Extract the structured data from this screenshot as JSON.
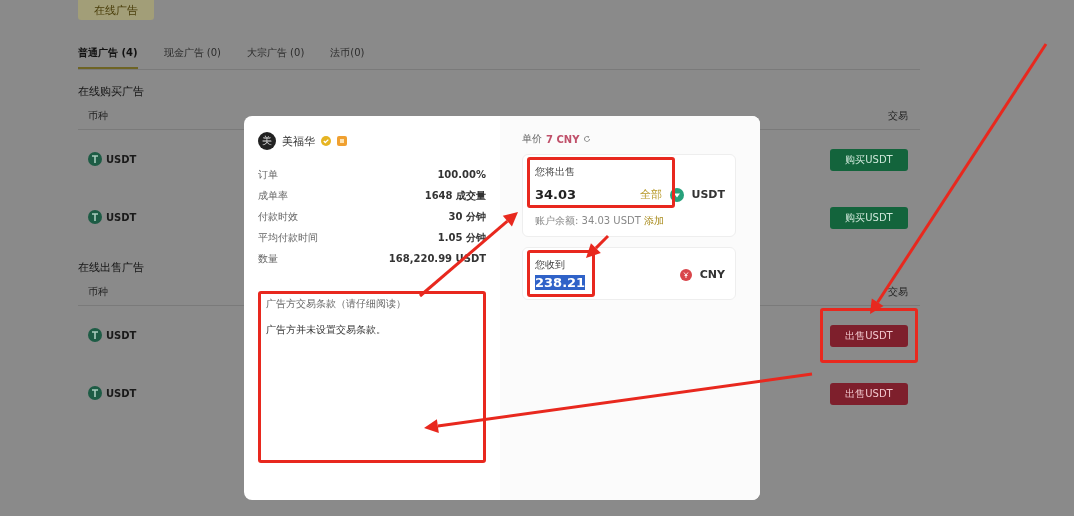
{
  "top_button": "在线广告",
  "tabs": [
    {
      "label": "普通广告 (4)",
      "selected": true
    },
    {
      "label": "现金广告 (0)",
      "selected": false
    },
    {
      "label": "大宗广告 (0)",
      "selected": false
    },
    {
      "label": "法币(0)",
      "selected": false
    }
  ],
  "sections": [
    {
      "title": "在线购买广告",
      "columns": [
        "币种",
        "交易"
      ],
      "rows": [
        {
          "coin": "USDT",
          "action": "购买USDT",
          "kind": "buy"
        },
        {
          "coin": "USDT",
          "action": "购买USDT",
          "kind": "buy"
        }
      ]
    },
    {
      "title": "在线出售广告",
      "columns": [
        "币种",
        "交易"
      ],
      "rows": [
        {
          "coin": "USDT",
          "action": "出售USDT",
          "kind": "sell"
        },
        {
          "coin": "USDT",
          "action": "出售USDT",
          "kind": "sell"
        }
      ]
    }
  ],
  "dialog": {
    "advertiser": {
      "avatar": "美",
      "name": "美福华"
    },
    "stats": [
      {
        "label": "订单",
        "value": "100.00%"
      },
      {
        "label": "成单率",
        "value": "1648 成交量"
      },
      {
        "label": "付款时效",
        "value": "30 分钟"
      },
      {
        "label": "平均付款时间",
        "value": "1.05 分钟"
      },
      {
        "label": "数量",
        "value": "168,220.99 USDT"
      }
    ],
    "terms": {
      "title": "广告方交易条款（请仔细阅读）",
      "body": "广告方并未设置交易条款。"
    },
    "price": {
      "label": "单价",
      "value": "7 CNY"
    },
    "sell": {
      "label": "您将出售",
      "value": "34.03",
      "max_link": "全部",
      "currency": "USDT",
      "balance": "账户余额: 34.03 USDT",
      "add_link": "添加"
    },
    "receive": {
      "label": "您收到",
      "value": "238.21",
      "selected": true,
      "currency": "CNY"
    }
  }
}
